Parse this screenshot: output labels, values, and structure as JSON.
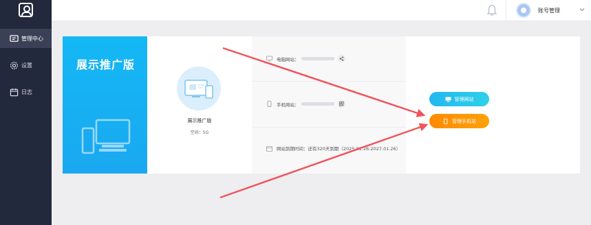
{
  "sidebar": {
    "logo_icon": "user-card-icon",
    "items": [
      {
        "label": "管理中心",
        "icon": "dashboard-icon",
        "active": true
      },
      {
        "label": "设置",
        "icon": "gear-icon",
        "active": false
      },
      {
        "label": "日志",
        "icon": "calendar-icon",
        "active": false
      }
    ]
  },
  "header": {
    "account_label": "账号管理"
  },
  "promo": {
    "title": "展示推广版"
  },
  "product": {
    "name": "展示推广版",
    "space": "空间：5G"
  },
  "info": {
    "pc_site_label": "电脑网站：",
    "mobile_site_label": "手机网站：",
    "expiry": "网站到期时间：还有320天到期（2025.01.26-2027.01.26）"
  },
  "buttons": {
    "manage_pc": "管理网站",
    "manage_mobile": "管理手机站"
  },
  "colors": {
    "sidebar_bg": "#23293c",
    "promo_blue": "#14b8f5",
    "button_blue": "#22b8f0",
    "button_orange": "#ff8a00",
    "annotation_red": "#f0545b"
  }
}
